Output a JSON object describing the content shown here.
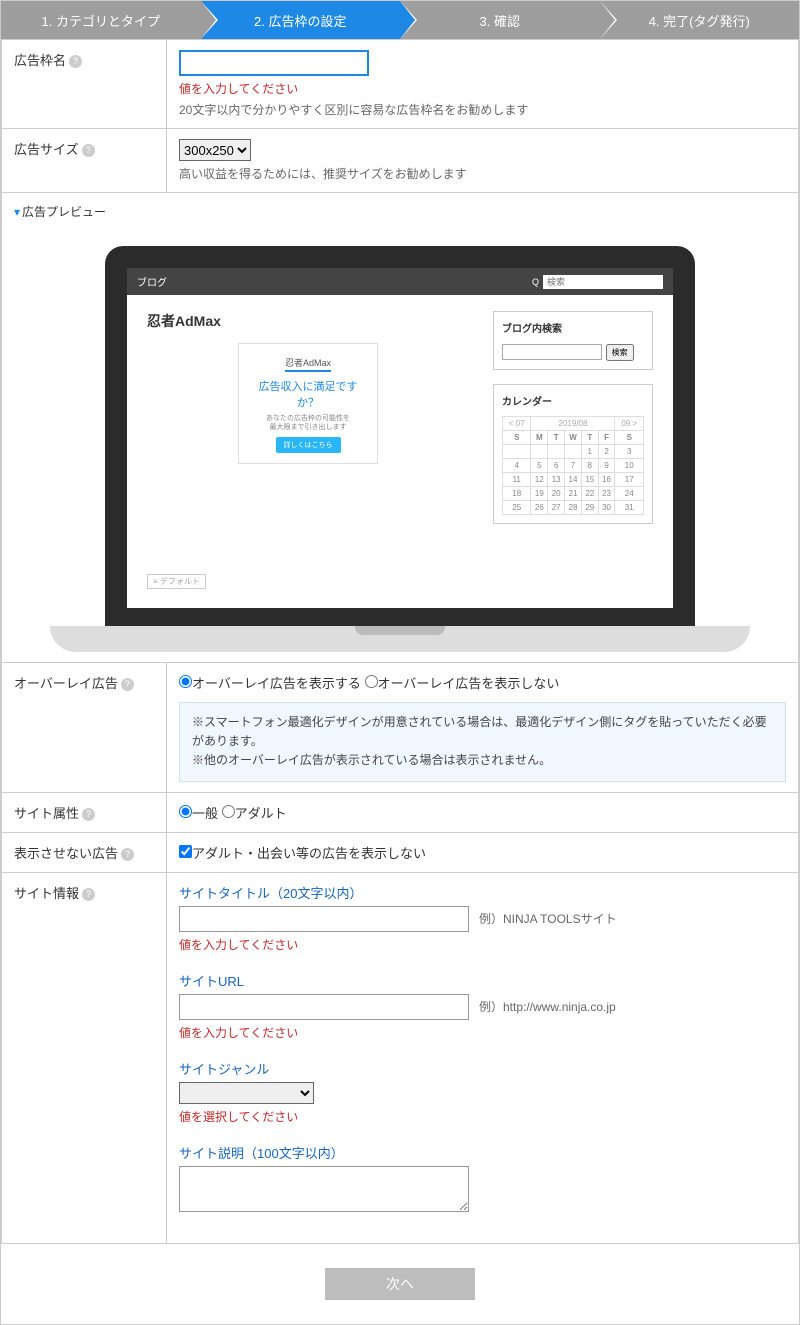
{
  "steps": [
    "1. カテゴリとタイプ",
    "2. 広告枠の設定",
    "3. 確認",
    "4. 完了(タグ発行)"
  ],
  "labels": {
    "adname": "広告枠名",
    "adsize": "広告サイズ",
    "preview": "広告プレビュー",
    "overlay": "オーバーレイ広告",
    "siteattr": "サイト属性",
    "hidead": "表示させない広告",
    "siteinfo": "サイト情報"
  },
  "adname": {
    "error": "値を入力してください",
    "hint": "20文字以内で分かりやすく区別に容易な広告枠名をお勧めします"
  },
  "adsize": {
    "value": "300x250",
    "hint": "高い収益を得るためには、推奨サイズをお勧めします"
  },
  "preview": {
    "blog_label": "ブログ",
    "search_ph": "検索",
    "title": "忍者AdMax",
    "ad": {
      "logo": "忍者AdMax",
      "q": "広告収入に満足ですか？",
      "sub1": "あなたの広告枠の可能性を",
      "sub2": "最大限まで引き出します",
      "btn": "詳しくはこちら"
    },
    "side_search": {
      "title": "ブログ内検索",
      "btn": "検索"
    },
    "calendar": {
      "title": "カレンダー",
      "month": "2019/08",
      "prev": "< 07",
      "next": "09 >",
      "dow": [
        "S",
        "M",
        "T",
        "W",
        "T",
        "F",
        "S"
      ],
      "weeks": [
        [
          "",
          "",
          "",
          "",
          "1",
          "2",
          "3"
        ],
        [
          "4",
          "5",
          "6",
          "7",
          "8",
          "9",
          "10"
        ],
        [
          "11",
          "12",
          "13",
          "14",
          "15",
          "16",
          "17"
        ],
        [
          "18",
          "19",
          "20",
          "21",
          "22",
          "23",
          "24"
        ],
        [
          "25",
          "26",
          "27",
          "28",
          "29",
          "30",
          "31"
        ]
      ]
    },
    "default_tag": "≡ デフォルト"
  },
  "overlay": {
    "opt_show": "オーバーレイ広告を表示する",
    "opt_hide": "オーバーレイ広告を表示しない",
    "note1": "※スマートフォン最適化デザインが用意されている場合は、最適化デザイン側にタグを貼っていただく必要があります。",
    "note2": "※他のオーバーレイ広告が表示されている場合は表示されません。"
  },
  "siteattr": {
    "opt1": "一般",
    "opt2": "アダルト"
  },
  "hidead": {
    "label": "アダルト・出会い等の広告を表示しない"
  },
  "siteinfo": {
    "title_label": "サイトタイトル（20文字以内）",
    "title_ex": "例）NINJA TOOLSサイト",
    "title_err": "値を入力してください",
    "url_label": "サイトURL",
    "url_ex": "例）http://www.ninja.co.jp",
    "url_err": "値を入力してください",
    "genre_label": "サイトジャンル",
    "genre_err": "値を選択してください",
    "desc_label": "サイト説明（100文字以内）"
  },
  "submit": "次へ",
  "chart_data": {
    "type": "table",
    "title": "2019/08",
    "columns": [
      "S",
      "M",
      "T",
      "W",
      "T",
      "F",
      "S"
    ],
    "rows": [
      [
        "",
        "",
        "",
        "",
        "1",
        "2",
        "3"
      ],
      [
        "4",
        "5",
        "6",
        "7",
        "8",
        "9",
        "10"
      ],
      [
        "11",
        "12",
        "13",
        "14",
        "15",
        "16",
        "17"
      ],
      [
        "18",
        "19",
        "20",
        "21",
        "22",
        "23",
        "24"
      ],
      [
        "25",
        "26",
        "27",
        "28",
        "29",
        "30",
        "31"
      ]
    ]
  }
}
